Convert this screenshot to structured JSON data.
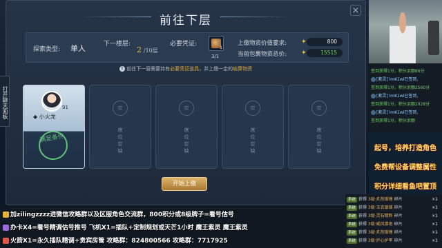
{
  "dialog": {
    "title": "前往下层",
    "close_icon": "×",
    "side_tab": "打开聊天面板",
    "info": {
      "explore_type_label": "探索类型:",
      "explore_type_value": "单人",
      "next_floor_label": "下一楼层:",
      "next_floor_current": "2",
      "next_floor_total": "/10层",
      "required_token_label": "必要凭证:",
      "token_badge": "1",
      "token_count": "3/1",
      "offer_req_label": "上缴物资价值要求:",
      "offer_req_value": "800",
      "pack_value_label": "当前包裹物资总价:",
      "pack_value_value": "15515"
    },
    "hint_prefix": "前往下一层需要持有",
    "hint_item1": "必要凭证道具",
    "hint_mid": "，并上缴一定的",
    "hint_item2": "结算物资",
    "slots": [
      {
        "filled": true,
        "player_name": "小火龙",
        "level": "91",
        "stamp": "满足条件"
      },
      {
        "filled": false,
        "circle": "空",
        "text": "席位空缺"
      },
      {
        "filled": false,
        "circle": "空",
        "text": "席位空缺"
      },
      {
        "filled": false,
        "circle": "空",
        "text": "席位空缺"
      },
      {
        "filled": false,
        "circle": "空",
        "text": "席位空缺"
      }
    ],
    "start_button": "开始上缴"
  },
  "chat": {
    "lines": [
      {
        "text": "签到获得1分，积分余额86分",
        "kind": "green"
      },
      {
        "text": "[紫灵] lmK1wi已签到,",
        "kind": "user"
      },
      {
        "text": "签到获得1分，积分余额2560分",
        "kind": "green"
      },
      {
        "text": "[紫灵] lmK1wi已签到,",
        "kind": "user"
      },
      {
        "text": "签到获得1分，积分余额2028分",
        "kind": "green"
      },
      {
        "text": "[紫灵] lmK1wi已签到,",
        "kind": "user"
      },
      {
        "text": "签到获得1分，积分余额",
        "kind": "green"
      }
    ]
  },
  "promo": [
    "起号，培养打造角色",
    "免费帮设备调整属性",
    "积分详细看鱼吧置顶"
  ],
  "banner": {
    "line1": "加zilingzzzz进微信攻略群以及区服角色交流群，800积分或8级牌子=看号估号",
    "line2": "办卡X4=看号精调估号推号  飞机X1=插队+定制规划或天芒1小时  魔王紫灵  魔王紫灵",
    "line3": "火箭X1=永久插队精调+贵宾房管  攻略群：824800566  攻略群：7717925"
  },
  "gifts": [
    {
      "tag": "系统",
      "text": "获得",
      "name": "3级·炙热锻锤",
      "suffix": "碎片",
      "count": "×1"
    },
    {
      "tag": "系统",
      "text": "获得",
      "name": "3级·玉衣银锦",
      "suffix": "碎片",
      "count": "×1"
    },
    {
      "tag": "系统",
      "text": "获得",
      "name": "3级·灵石精粹",
      "suffix": "碎片",
      "count": "×1"
    },
    {
      "tag": "系统",
      "text": "获得",
      "name": "3级·威风猎袍",
      "suffix": "碎片",
      "count": "×1"
    },
    {
      "tag": "系统",
      "text": "获得",
      "name": "3级·炙热锻锤",
      "suffix": "碎片",
      "count": "×1"
    },
    {
      "tag": "系统",
      "text": "获得",
      "name": "3级·护心护甲",
      "suffix": "碎片",
      "count": "×1"
    }
  ]
}
